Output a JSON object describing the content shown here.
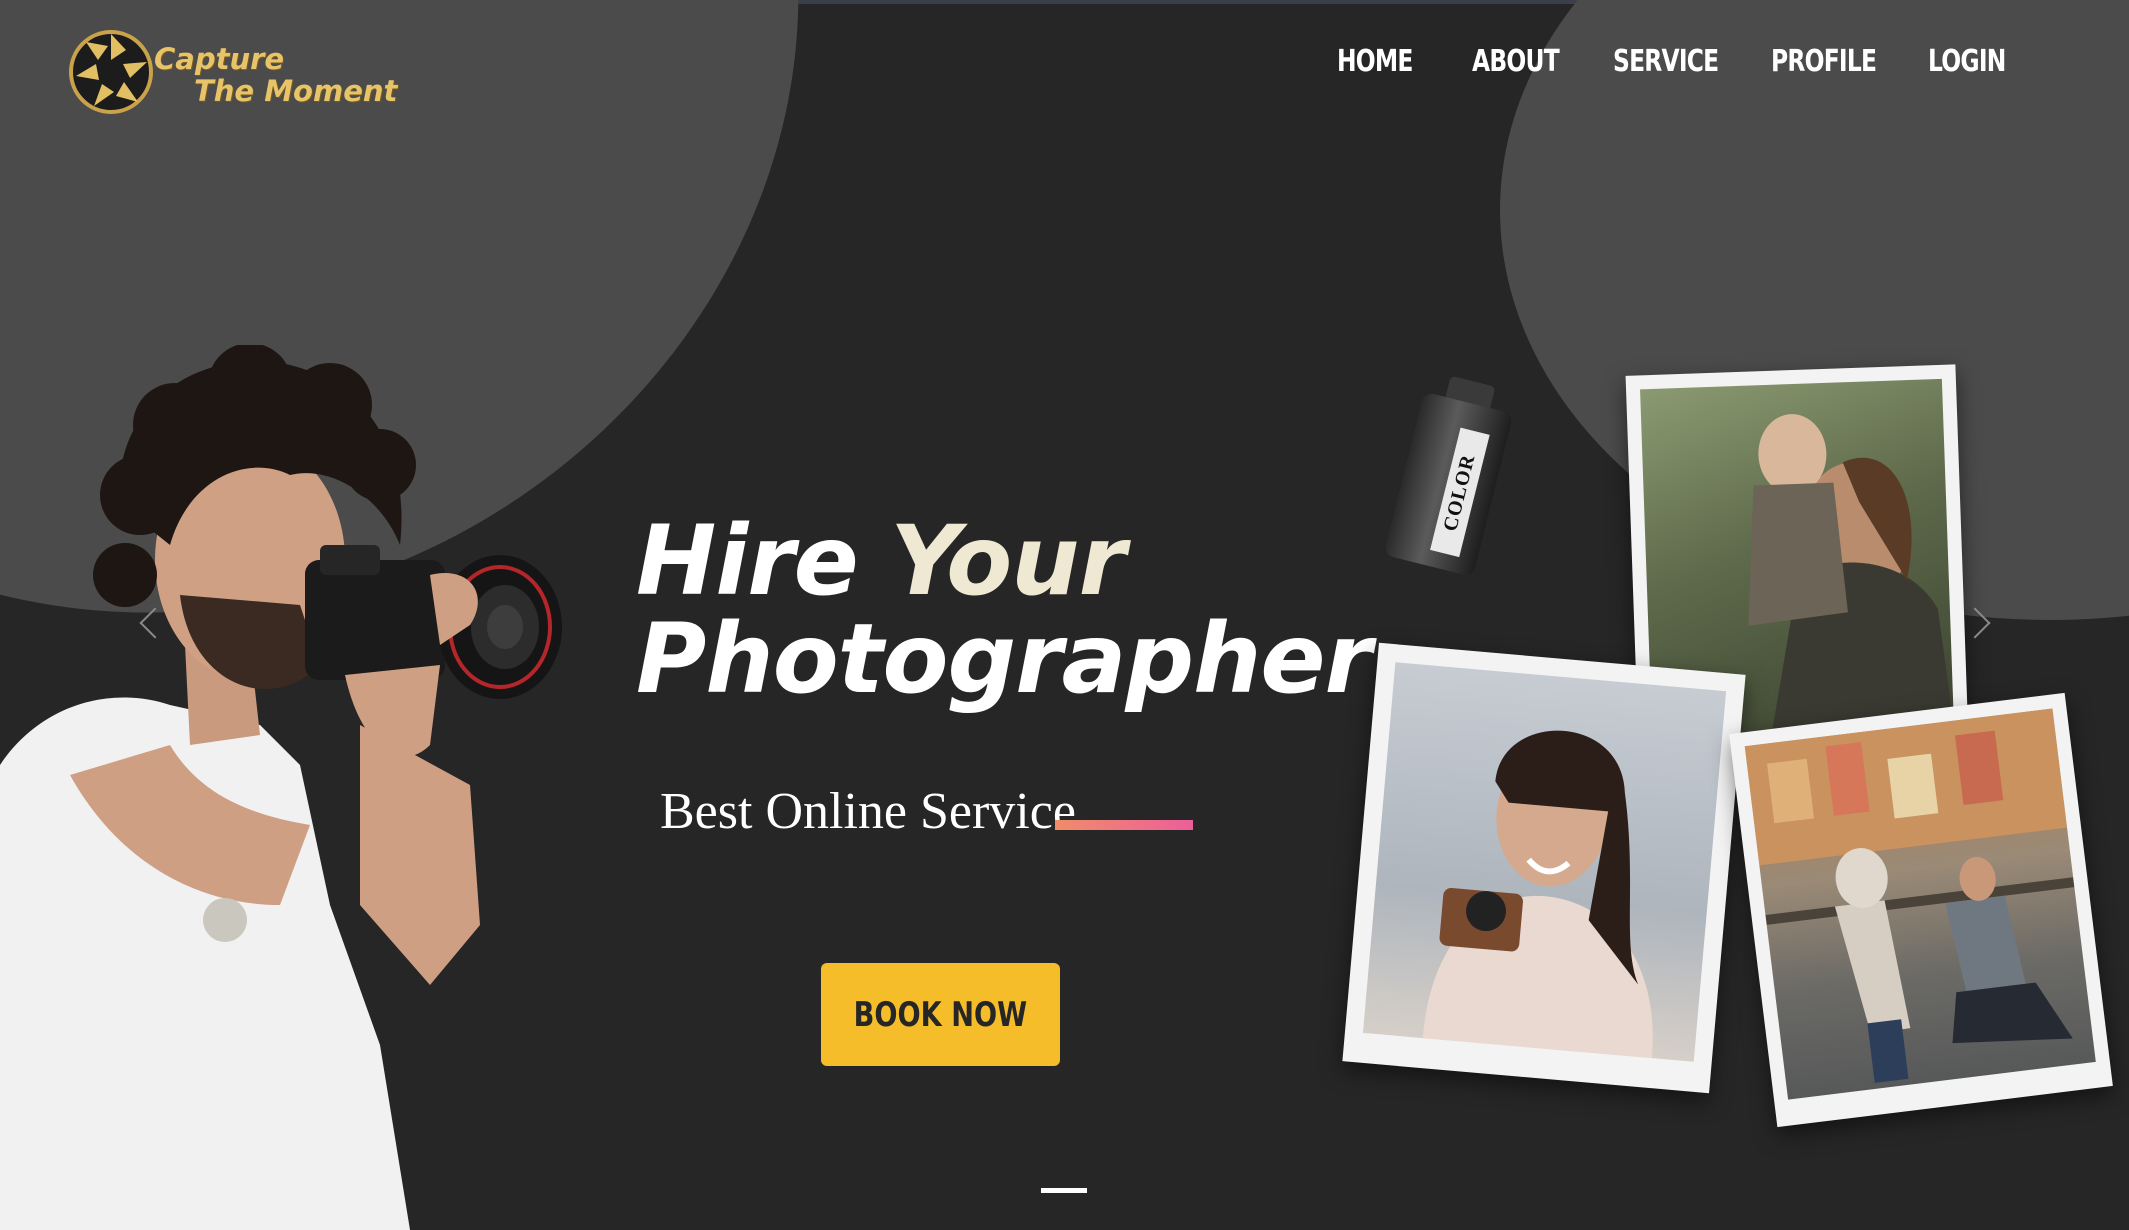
{
  "brand": {
    "line1": "Capture",
    "line2": "The Moment",
    "logo_icon": "camera-aperture-icon",
    "accent_color": "#e7c46a"
  },
  "nav": {
    "items": [
      "HOME",
      "ABOUT",
      "SERVICE",
      "PROFILE",
      "LOGIN"
    ]
  },
  "hero": {
    "title_word1": "Hire",
    "title_word2": "Your",
    "title_word3": "Photographer",
    "subtitle": "Best Online Service",
    "cta_label": "BOOK NOW",
    "cta_color": "#f6bd2a",
    "accent_gradient": [
      "#f08c6a",
      "#ec5f9a"
    ]
  },
  "carousel": {
    "prev_icon": "chevron-left-icon",
    "next_icon": "chevron-right-icon",
    "slide_count": 1,
    "active_slide": 1
  },
  "decor": {
    "film_label": "COLOR",
    "photos": [
      "mother-and-child-photo",
      "woman-with-camera-photo",
      "proposal-photo"
    ]
  },
  "colors": {
    "background": "#262626",
    "blob": "#4b4b4b",
    "text": "#ffffff",
    "cream": "#efe8d2"
  }
}
